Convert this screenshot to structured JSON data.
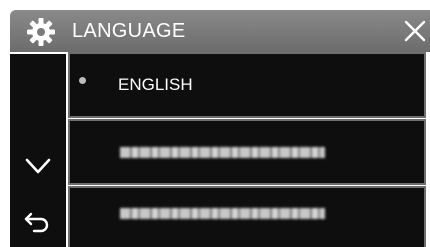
{
  "header": {
    "title": "LANGUAGE",
    "settings_icon": "gear-icon",
    "close_icon": "close-icon"
  },
  "navigation": {
    "down_icon": "chevron-down-icon",
    "back_icon": "back-arrow-icon"
  },
  "language_list": {
    "items": [
      {
        "label": "ENGLISH",
        "selected": true
      },
      {
        "label": "",
        "selected": false
      },
      {
        "label": "",
        "selected": false
      }
    ]
  },
  "colors": {
    "header_bg": "#7a7a7a",
    "row_bg": "#0e0e0e",
    "row_border": "#6e6e6e",
    "text": "#ffffff"
  }
}
